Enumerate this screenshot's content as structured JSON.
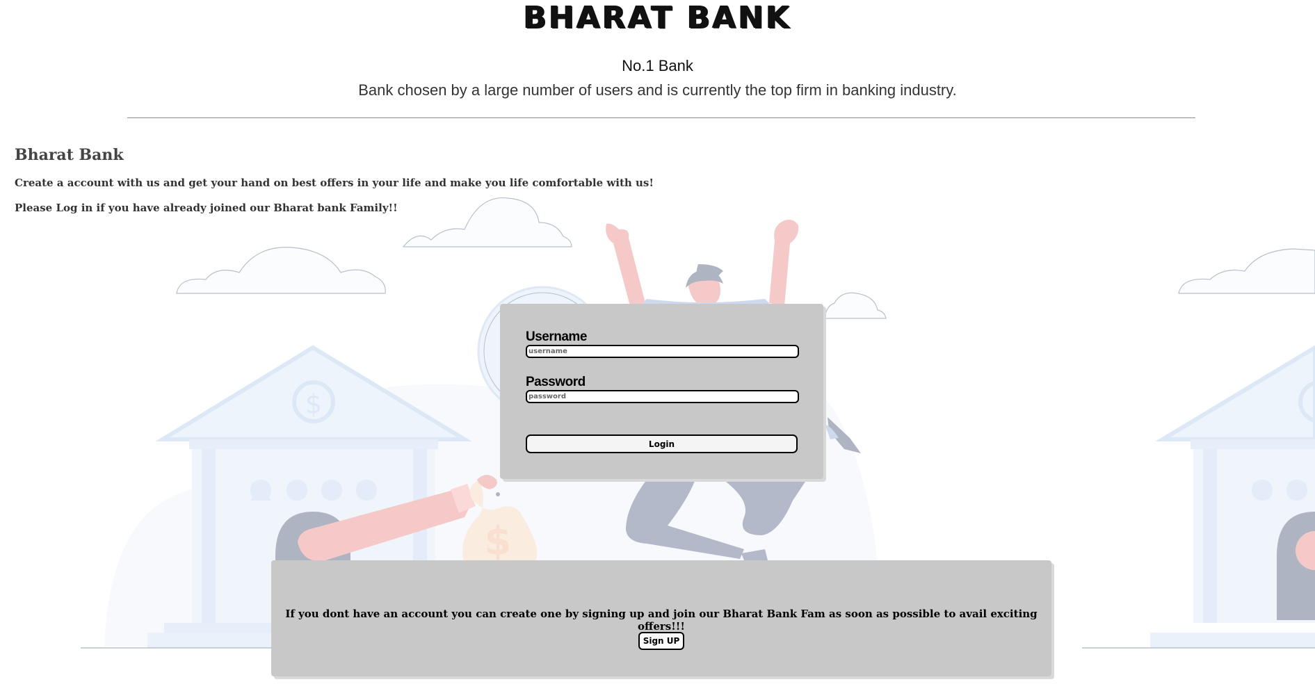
{
  "header": {
    "brand": "BHARAT BANK",
    "tagline": "No.1 Bank",
    "subtitle": "Bank chosen by a large number of users and is currently the top firm in banking industry."
  },
  "intro": {
    "heading": "Bharat Bank",
    "line1": "Create a account with us and get your hand on best offers in your life and make you life comfortable with us!",
    "line2": "Please Log in if you have already joined our Bharat bank Family!!"
  },
  "login": {
    "username_label": "Username",
    "username_placeholder": "username",
    "password_label": "Password",
    "password_placeholder": "password",
    "button_label": "Login"
  },
  "signup": {
    "text": "If you dont have an account you can create one by signing up and join our Bharat Bank Fam as soon as possible to avail exciting offers!!!",
    "button_label": "Sign UP"
  },
  "illustration": {
    "symbol": "$",
    "colors": {
      "bank": "#eef4fc",
      "bank_outline": "#dde8f6",
      "skin": "#f6c9c9",
      "pants": "#b3b9c8",
      "moneybag": "#fbece0",
      "cloud": "#b8c0cc",
      "card": "#c8c8c8"
    }
  }
}
